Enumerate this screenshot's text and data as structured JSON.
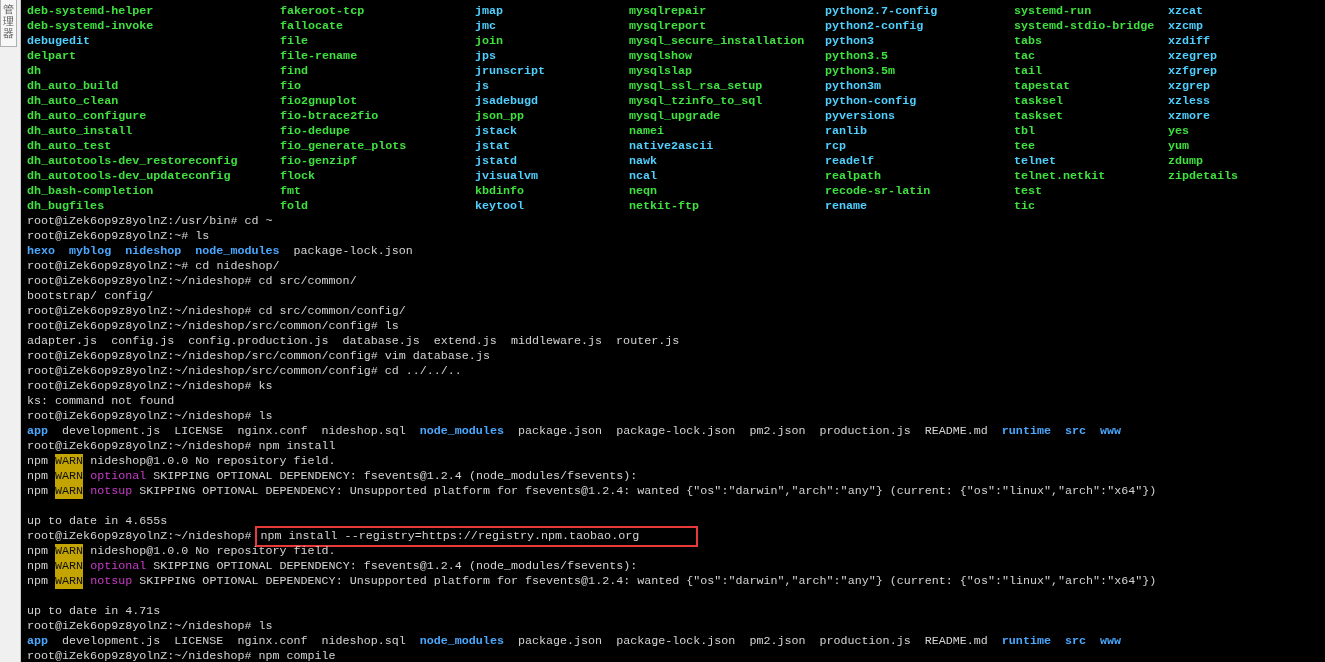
{
  "side_tab": {
    "label": "管理器"
  },
  "command_columns": [
    {
      "items": [
        {
          "name": "deb-systemd-helper",
          "kind": "exec"
        },
        {
          "name": "deb-systemd-invoke",
          "kind": "exec"
        },
        {
          "name": "debugedit",
          "kind": "link"
        },
        {
          "name": "delpart",
          "kind": "exec"
        },
        {
          "name": "dh",
          "kind": "exec"
        },
        {
          "name": "dh_auto_build",
          "kind": "exec"
        },
        {
          "name": "dh_auto_clean",
          "kind": "exec"
        },
        {
          "name": "dh_auto_configure",
          "kind": "exec"
        },
        {
          "name": "dh_auto_install",
          "kind": "exec"
        },
        {
          "name": "dh_auto_test",
          "kind": "exec"
        },
        {
          "name": "dh_autotools-dev_restoreconfig",
          "kind": "exec"
        },
        {
          "name": "dh_autotools-dev_updateconfig",
          "kind": "exec"
        },
        {
          "name": "dh_bash-completion",
          "kind": "exec"
        },
        {
          "name": "dh_bugfiles",
          "kind": "exec"
        }
      ]
    },
    {
      "items": [
        {
          "name": "fakeroot-tcp",
          "kind": "exec"
        },
        {
          "name": "fallocate",
          "kind": "exec"
        },
        {
          "name": "file",
          "kind": "exec"
        },
        {
          "name": "file-rename",
          "kind": "exec"
        },
        {
          "name": "find",
          "kind": "exec"
        },
        {
          "name": "fio",
          "kind": "exec"
        },
        {
          "name": "fio2gnuplot",
          "kind": "exec"
        },
        {
          "name": "fio-btrace2fio",
          "kind": "exec"
        },
        {
          "name": "fio-dedupe",
          "kind": "exec"
        },
        {
          "name": "fio_generate_plots",
          "kind": "exec"
        },
        {
          "name": "fio-genzipf",
          "kind": "exec"
        },
        {
          "name": "flock",
          "kind": "exec"
        },
        {
          "name": "fmt",
          "kind": "exec"
        },
        {
          "name": "fold",
          "kind": "exec"
        }
      ]
    },
    {
      "items": [
        {
          "name": "jmap",
          "kind": "link"
        },
        {
          "name": "jmc",
          "kind": "link"
        },
        {
          "name": "join",
          "kind": "exec"
        },
        {
          "name": "jps",
          "kind": "link"
        },
        {
          "name": "jrunscript",
          "kind": "link"
        },
        {
          "name": "js",
          "kind": "link"
        },
        {
          "name": "jsadebugd",
          "kind": "link"
        },
        {
          "name": "json_pp",
          "kind": "exec"
        },
        {
          "name": "jstack",
          "kind": "link"
        },
        {
          "name": "jstat",
          "kind": "link"
        },
        {
          "name": "jstatd",
          "kind": "link"
        },
        {
          "name": "jvisualvm",
          "kind": "link"
        },
        {
          "name": "kbdinfo",
          "kind": "exec"
        },
        {
          "name": "keytool",
          "kind": "link"
        }
      ]
    },
    {
      "items": [
        {
          "name": "mysqlrepair",
          "kind": "exec"
        },
        {
          "name": "mysqlreport",
          "kind": "exec"
        },
        {
          "name": "mysql_secure_installation",
          "kind": "exec"
        },
        {
          "name": "mysqlshow",
          "kind": "exec"
        },
        {
          "name": "mysqlslap",
          "kind": "exec"
        },
        {
          "name": "mysql_ssl_rsa_setup",
          "kind": "exec"
        },
        {
          "name": "mysql_tzinfo_to_sql",
          "kind": "exec"
        },
        {
          "name": "mysql_upgrade",
          "kind": "exec"
        },
        {
          "name": "namei",
          "kind": "exec"
        },
        {
          "name": "native2ascii",
          "kind": "link"
        },
        {
          "name": "nawk",
          "kind": "link"
        },
        {
          "name": "ncal",
          "kind": "link"
        },
        {
          "name": "neqn",
          "kind": "exec"
        },
        {
          "name": "netkit-ftp",
          "kind": "exec"
        }
      ]
    },
    {
      "items": [
        {
          "name": "python2.7-config",
          "kind": "link"
        },
        {
          "name": "python2-config",
          "kind": "link"
        },
        {
          "name": "python3",
          "kind": "link"
        },
        {
          "name": "python3.5",
          "kind": "exec"
        },
        {
          "name": "python3.5m",
          "kind": "exec"
        },
        {
          "name": "python3m",
          "kind": "link"
        },
        {
          "name": "python-config",
          "kind": "link"
        },
        {
          "name": "pyversions",
          "kind": "link"
        },
        {
          "name": "ranlib",
          "kind": "link"
        },
        {
          "name": "rcp",
          "kind": "link"
        },
        {
          "name": "readelf",
          "kind": "link"
        },
        {
          "name": "realpath",
          "kind": "exec"
        },
        {
          "name": "recode-sr-latin",
          "kind": "exec"
        },
        {
          "name": "rename",
          "kind": "link"
        }
      ]
    },
    {
      "items": [
        {
          "name": "systemd-run",
          "kind": "exec"
        },
        {
          "name": "systemd-stdio-bridge",
          "kind": "exec"
        },
        {
          "name": "tabs",
          "kind": "exec"
        },
        {
          "name": "tac",
          "kind": "exec"
        },
        {
          "name": "tail",
          "kind": "exec"
        },
        {
          "name": "tapestat",
          "kind": "exec"
        },
        {
          "name": "tasksel",
          "kind": "exec"
        },
        {
          "name": "taskset",
          "kind": "exec"
        },
        {
          "name": "tbl",
          "kind": "exec"
        },
        {
          "name": "tee",
          "kind": "exec"
        },
        {
          "name": "telnet",
          "kind": "link"
        },
        {
          "name": "telnet.netkit",
          "kind": "exec"
        },
        {
          "name": "test",
          "kind": "exec"
        },
        {
          "name": "tic",
          "kind": "exec"
        }
      ]
    },
    {
      "items": [
        {
          "name": "xzcat",
          "kind": "link"
        },
        {
          "name": "xzcmp",
          "kind": "link"
        },
        {
          "name": "xzdiff",
          "kind": "link"
        },
        {
          "name": "xzegrep",
          "kind": "link"
        },
        {
          "name": "xzfgrep",
          "kind": "link"
        },
        {
          "name": "xzgrep",
          "kind": "link"
        },
        {
          "name": "xzless",
          "kind": "link"
        },
        {
          "name": "xzmore",
          "kind": "link"
        },
        {
          "name": "yes",
          "kind": "exec"
        },
        {
          "name": "yum",
          "kind": "exec"
        },
        {
          "name": "zdump",
          "kind": "exec"
        },
        {
          "name": "zipdetails",
          "kind": "exec"
        }
      ]
    }
  ],
  "lines": [
    {
      "kind": "prompt",
      "prompt": "root@iZek6op9z8yolnZ:/usr/bin#",
      "command": "cd ~",
      "highlighted": false
    },
    {
      "kind": "prompt",
      "prompt": "root@iZek6op9z8yolnZ:~#",
      "command": "ls",
      "highlighted": false
    },
    {
      "kind": "listing",
      "items": [
        {
          "name": "hexo",
          "dir": true
        },
        {
          "name": "myblog",
          "dir": true
        },
        {
          "name": "nideshop",
          "dir": true
        },
        {
          "name": "node_modules",
          "dir": true
        },
        {
          "name": "package-lock.json",
          "dir": false
        }
      ]
    },
    {
      "kind": "prompt",
      "prompt": "root@iZek6op9z8yolnZ:~#",
      "command": "cd nideshop/",
      "highlighted": false
    },
    {
      "kind": "prompt",
      "prompt": "root@iZek6op9z8yolnZ:~/nideshop#",
      "command": "cd src/common/",
      "highlighted": false
    },
    {
      "kind": "output",
      "text": "bootstrap/ config/"
    },
    {
      "kind": "prompt",
      "prompt": "root@iZek6op9z8yolnZ:~/nideshop#",
      "command": "cd src/common/config/",
      "highlighted": false
    },
    {
      "kind": "prompt",
      "prompt": "root@iZek6op9z8yolnZ:~/nideshop/src/common/config#",
      "command": "ls",
      "highlighted": false
    },
    {
      "kind": "listing",
      "items": [
        {
          "name": "adapter.js",
          "dir": false
        },
        {
          "name": "config.js",
          "dir": false
        },
        {
          "name": "config.production.js",
          "dir": false
        },
        {
          "name": "database.js",
          "dir": false
        },
        {
          "name": "extend.js",
          "dir": false
        },
        {
          "name": "middleware.js",
          "dir": false
        },
        {
          "name": "router.js",
          "dir": false
        }
      ]
    },
    {
      "kind": "prompt",
      "prompt": "root@iZek6op9z8yolnZ:~/nideshop/src/common/config#",
      "command": "vim database.js",
      "highlighted": false
    },
    {
      "kind": "prompt",
      "prompt": "root@iZek6op9z8yolnZ:~/nideshop/src/common/config#",
      "command": "cd ../../..",
      "highlighted": false
    },
    {
      "kind": "prompt",
      "prompt": "root@iZek6op9z8yolnZ:~/nideshop#",
      "command": "ks",
      "highlighted": false
    },
    {
      "kind": "output",
      "text": "ks: command not found"
    },
    {
      "kind": "prompt",
      "prompt": "root@iZek6op9z8yolnZ:~/nideshop#",
      "command": "ls",
      "highlighted": false
    },
    {
      "kind": "listing",
      "items": [
        {
          "name": "app",
          "dir": true
        },
        {
          "name": "development.js",
          "dir": false
        },
        {
          "name": "LICENSE",
          "dir": false
        },
        {
          "name": "nginx.conf",
          "dir": false
        },
        {
          "name": "nideshop.sql",
          "dir": false
        },
        {
          "name": "node_modules",
          "dir": true
        },
        {
          "name": "package.json",
          "dir": false
        },
        {
          "name": "package-lock.json",
          "dir": false
        },
        {
          "name": "pm2.json",
          "dir": false
        },
        {
          "name": "production.js",
          "dir": false
        },
        {
          "name": "README.md",
          "dir": false
        },
        {
          "name": "runtime",
          "dir": true
        },
        {
          "name": "src",
          "dir": true
        },
        {
          "name": "www",
          "dir": true
        }
      ]
    },
    {
      "kind": "prompt",
      "prompt": "root@iZek6op9z8yolnZ:~/nideshop#",
      "command": "npm install",
      "highlighted": false
    },
    {
      "kind": "npm",
      "prefix": "npm",
      "badge": "WARN",
      "text": "nideshop@1.0.0 No repository field."
    },
    {
      "kind": "npm",
      "prefix": "npm",
      "badge": "WARN",
      "tag": "optional",
      "text": "SKIPPING OPTIONAL DEPENDENCY: fsevents@1.2.4 (node_modules/fsevents):"
    },
    {
      "kind": "npm",
      "prefix": "npm",
      "badge": "WARN",
      "tag": "notsup",
      "text": "SKIPPING OPTIONAL DEPENDENCY: Unsupported platform for fsevents@1.2.4: wanted {\"os\":\"darwin\",\"arch\":\"any\"} (current: {\"os\":\"linux\",\"arch\":\"x64\"})"
    },
    {
      "kind": "blank"
    },
    {
      "kind": "output",
      "text": "up to date in 4.655s"
    },
    {
      "kind": "prompt",
      "prompt": "root@iZek6op9z8yolnZ:~/nideshop#",
      "command": "npm install --registry=https://registry.npm.taobao.org",
      "highlighted": true
    },
    {
      "kind": "npm",
      "prefix": "npm",
      "badge": "WARN",
      "text": "nideshop@1.0.0 No repository field."
    },
    {
      "kind": "npm",
      "prefix": "npm",
      "badge": "WARN",
      "tag": "optional",
      "text": "SKIPPING OPTIONAL DEPENDENCY: fsevents@1.2.4 (node_modules/fsevents):"
    },
    {
      "kind": "npm",
      "prefix": "npm",
      "badge": "WARN",
      "tag": "notsup",
      "text": "SKIPPING OPTIONAL DEPENDENCY: Unsupported platform for fsevents@1.2.4: wanted {\"os\":\"darwin\",\"arch\":\"any\"} (current: {\"os\":\"linux\",\"arch\":\"x64\"})"
    },
    {
      "kind": "blank"
    },
    {
      "kind": "output",
      "text": "up to date in 4.71s"
    },
    {
      "kind": "prompt",
      "prompt": "root@iZek6op9z8yolnZ:~/nideshop#",
      "command": "ls",
      "highlighted": false
    },
    {
      "kind": "listing",
      "items": [
        {
          "name": "app",
          "dir": true
        },
        {
          "name": "development.js",
          "dir": false
        },
        {
          "name": "LICENSE",
          "dir": false
        },
        {
          "name": "nginx.conf",
          "dir": false
        },
        {
          "name": "nideshop.sql",
          "dir": false
        },
        {
          "name": "node_modules",
          "dir": true
        },
        {
          "name": "package.json",
          "dir": false
        },
        {
          "name": "package-lock.json",
          "dir": false
        },
        {
          "name": "pm2.json",
          "dir": false
        },
        {
          "name": "production.js",
          "dir": false
        },
        {
          "name": "README.md",
          "dir": false
        },
        {
          "name": "runtime",
          "dir": true
        },
        {
          "name": "src",
          "dir": true
        },
        {
          "name": "www",
          "dir": true
        }
      ]
    },
    {
      "kind": "prompt",
      "prompt": "root@iZek6op9z8yolnZ:~/nideshop#",
      "command": "npm compile",
      "highlighted": false
    }
  ]
}
